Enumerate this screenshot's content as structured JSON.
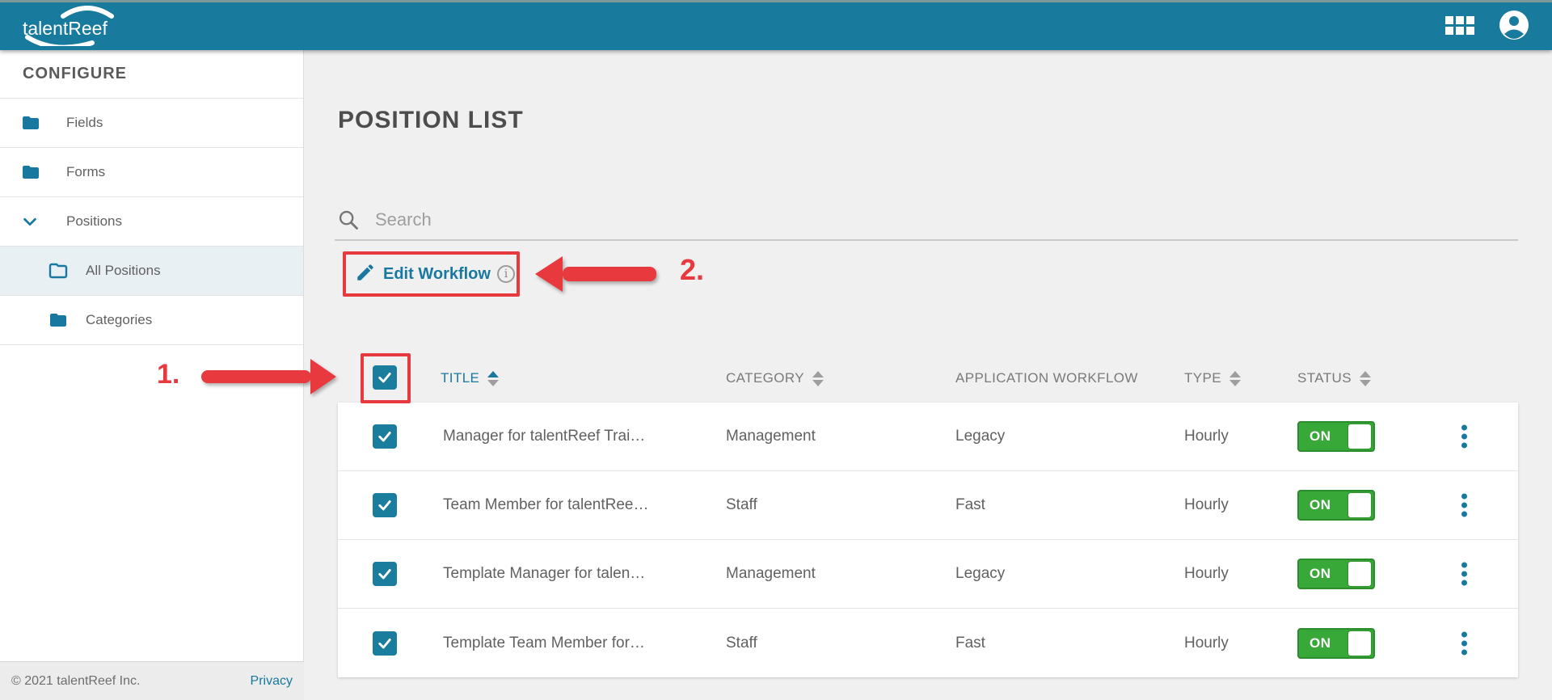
{
  "brand": {
    "logo_text": "talentReef"
  },
  "header": {
    "icons": [
      {
        "name": "apps-grid-icon"
      },
      {
        "name": "account-icon"
      }
    ]
  },
  "sidebar": {
    "heading": "CONFIGURE",
    "items": [
      {
        "label": "Fields",
        "icon": "folder-icon",
        "indent": 0,
        "active": false
      },
      {
        "label": "Forms",
        "icon": "folder-icon",
        "indent": 0,
        "active": false
      },
      {
        "label": "Positions",
        "icon": "chevron-down-icon",
        "indent": 0,
        "active": false,
        "expanded": true
      },
      {
        "label": "All Positions",
        "icon": "folder-outline-icon",
        "indent": 1,
        "active": true
      },
      {
        "label": "Categories",
        "icon": "folder-icon",
        "indent": 1,
        "active": false
      }
    ],
    "footer": {
      "copyright": "© 2021 talentReef Inc.",
      "privacy_label": "Privacy"
    }
  },
  "main": {
    "title": "POSITION LIST",
    "search": {
      "placeholder": "Search",
      "value": ""
    },
    "edit_workflow": {
      "label": "Edit Workflow",
      "icons": [
        "pencil-icon",
        "info-icon"
      ]
    },
    "table": {
      "columns": [
        {
          "label": "TITLE",
          "sortable": true,
          "sort_active": true
        },
        {
          "label": "CATEGORY",
          "sortable": true,
          "sort_active": false
        },
        {
          "label": "APPLICATION WORKFLOW",
          "sortable": false,
          "sort_active": false
        },
        {
          "label": "TYPE",
          "sortable": true,
          "sort_active": false
        },
        {
          "label": "STATUS",
          "sortable": true,
          "sort_active": false
        }
      ],
      "rows": [
        {
          "checked": true,
          "title": "Manager for talentReef Trai…",
          "category": "Management",
          "application_workflow": "Legacy",
          "type": "Hourly",
          "status": "ON"
        },
        {
          "checked": true,
          "title": "Team Member for talentRee…",
          "category": "Staff",
          "application_workflow": "Fast",
          "type": "Hourly",
          "status": "ON"
        },
        {
          "checked": true,
          "title": "Template Manager for talen…",
          "category": "Management",
          "application_workflow": "Legacy",
          "type": "Hourly",
          "status": "ON"
        },
        {
          "checked": true,
          "title": "Template Team Member for…",
          "category": "Staff",
          "application_workflow": "Fast",
          "type": "Hourly",
          "status": "ON"
        }
      ]
    }
  },
  "annotations": {
    "step1": "1.",
    "step2": "2."
  },
  "colors": {
    "header_teal": "#187a9d",
    "accent_teal": "#1878a0",
    "annotation_red": "#e8393f",
    "toggle_green": "#38a838",
    "page_bg": "#f0f0f0",
    "active_row_bg": "#e9f0f4"
  }
}
